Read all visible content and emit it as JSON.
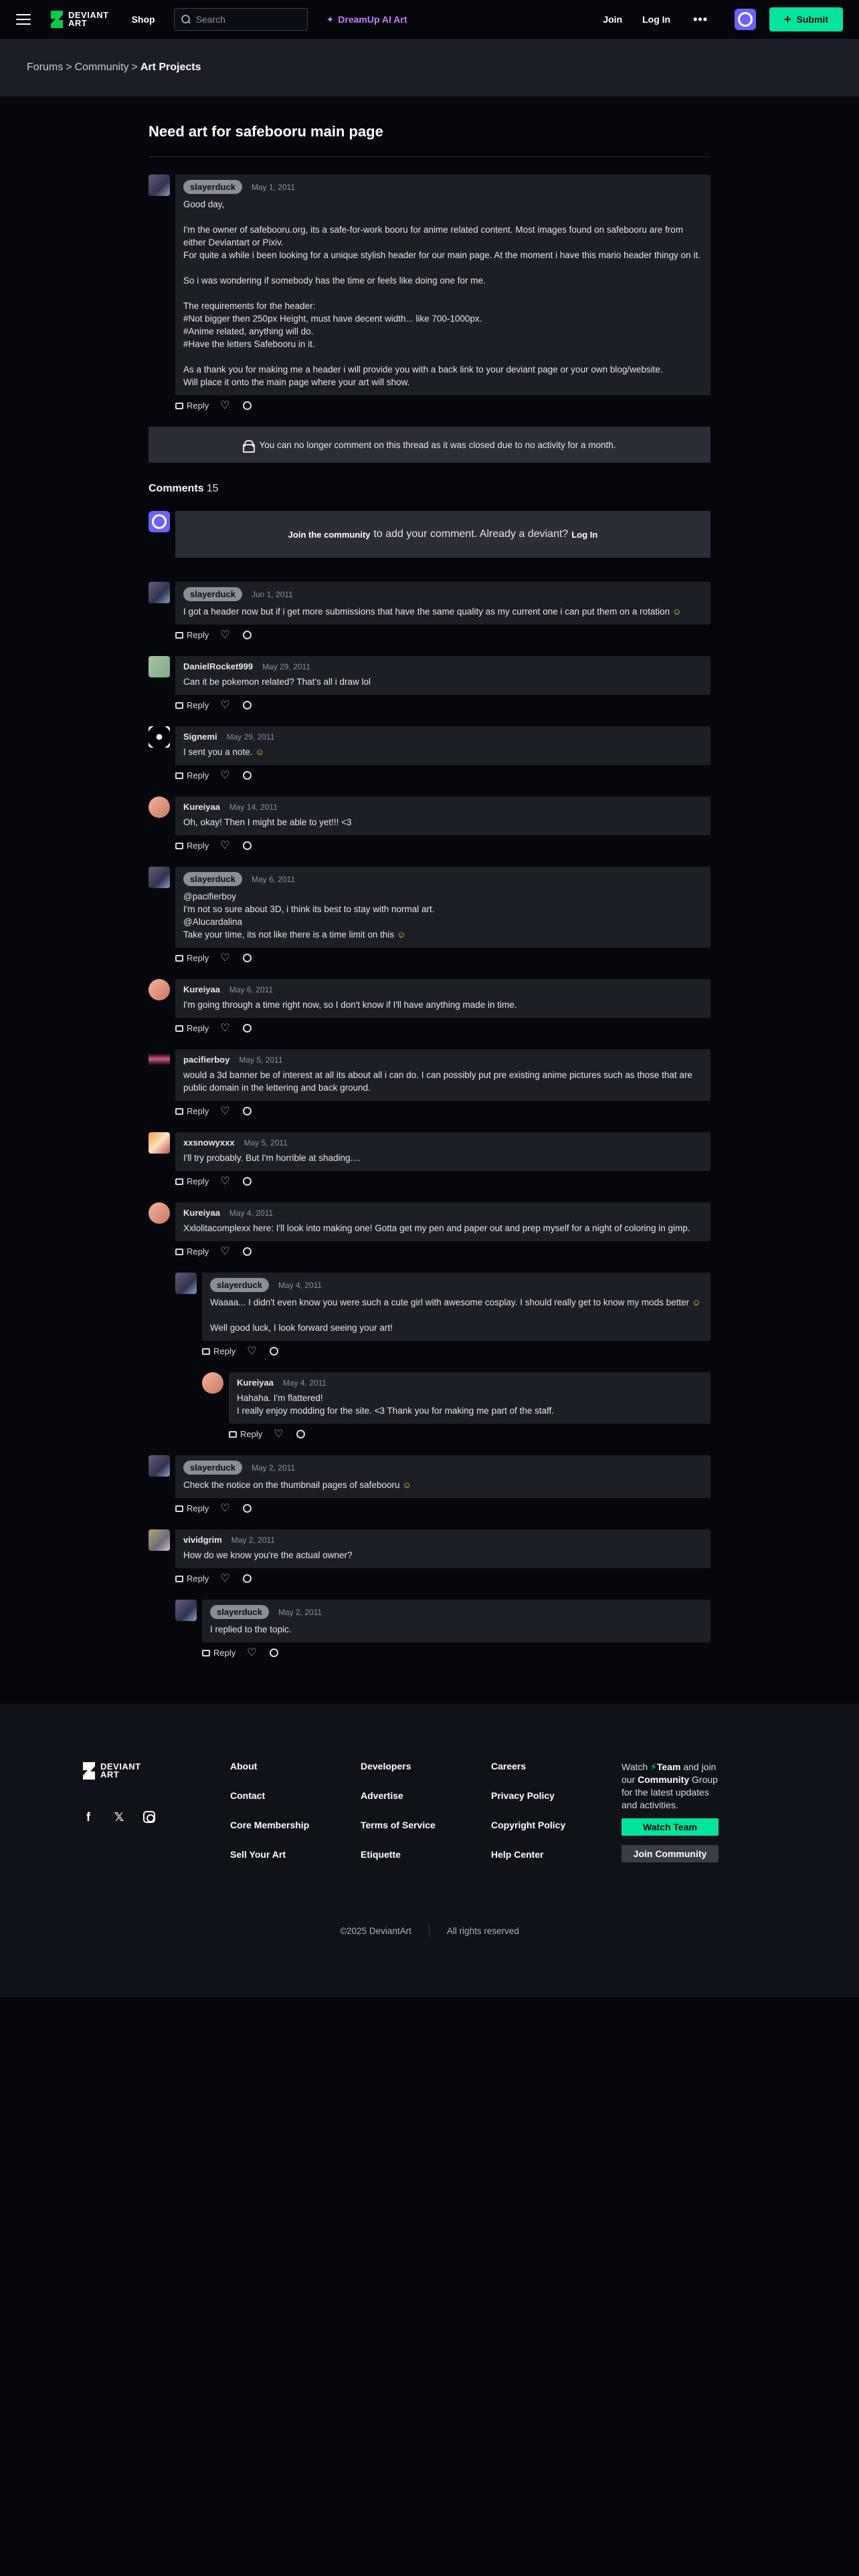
{
  "header": {
    "logo_line1": "DEVIANT",
    "logo_line2": "ART",
    "shop": "Shop",
    "search_placeholder": "Search",
    "dreamup": "DreamUp AI Art",
    "join": "Join",
    "login": "Log In",
    "more": "•••",
    "submit": "Submit"
  },
  "breadcrumb": [
    "Forums",
    "Community",
    "Art Projects"
  ],
  "thread": {
    "title": "Need art for safebooru main page",
    "op": {
      "user": "slayerduck",
      "date": "May 1, 2011",
      "text": "Good day,\n\nI'm the owner of safebooru.org, its a safe-for-work booru for anime related content. Most images found on safebooru are from either Deviantart or Pixiv.\nFor quite a while i been looking for a unique stylish header for our main page. At the moment i have this mario header thingy on it.\n\nSo i was wondering if somebody has the time or feels like doing one for me.\n\nThe requirements for the header:\n#Not bigger then 250px Height, must have decent width... like 700-1000px.\n#Anime related, anything will do.\n#Have the letters Safebooru in it.\n\nAs a thank you for making me a header i will provide you with a back link to your deviant page or your own blog/website.\nWill place it onto the main page where your art will show."
    },
    "reply_label": "Reply",
    "closed_notice": "You can no longer comment on this thread as it was closed due to no activity for a month."
  },
  "comments_label": "Comments",
  "comments_count": "15",
  "join_box": {
    "join": "Join the community",
    "middle": "to add your comment. Already a deviant?",
    "login": "Log In"
  },
  "comments": [
    {
      "user": "slayerduck",
      "badge": true,
      "date": "Jun 1, 2011",
      "text": "I got a header now but if i get more submissions that have the same quality as my current one i can put them on a rotation",
      "emoji": true
    },
    {
      "user": "DanielRocket999",
      "badge": false,
      "date": "May 29, 2011",
      "text": "Can it be pokemon related? That's all i draw lol"
    },
    {
      "user": "Signemi",
      "badge": false,
      "date": "May 29, 2011",
      "text": "I sent you a note.",
      "emoji": true
    },
    {
      "user": "Kureiyaa",
      "badge": false,
      "date": "May 14, 2011",
      "text": "Oh, okay! Then I might be able to yet!!! <3"
    },
    {
      "user": "slayerduck",
      "badge": true,
      "date": "May 6, 2011",
      "text": "@pacifierboy\nI'm not so sure about 3D, i think its best to stay with normal art.\n@Alucardalina\nTake your time, its not like there is a time limit on this",
      "emoji": true
    },
    {
      "user": "Kureiyaa",
      "badge": false,
      "date": "May 6, 2011",
      "text": "I'm going through a time right now, so I don't know if I'll have anything made in time."
    },
    {
      "user": "pacifierboy",
      "badge": false,
      "date": "May 5, 2011",
      "text": "would a 3d banner be of interest at all its about all i can do. I can possibly put pre existing anime pictures such as those that are public domain in the lettering and back ground."
    },
    {
      "user": "xxsnowyxxx",
      "badge": false,
      "date": "May 5, 2011",
      "text": "I'll try probably. But I'm horrible at shading...."
    },
    {
      "user": "Kureiyaa",
      "badge": false,
      "date": "May 4, 2011",
      "text": "Xxlolitacomplexx here: I'll look into making one! Gotta get my pen and paper out and prep myself for a night of coloring in gimp."
    },
    {
      "user": "slayerduck",
      "badge": true,
      "date": "May 4, 2011",
      "text": "Waaaa... I didn't even know you were such a cute girl with awesome cosplay. I should really get to know my mods better",
      "text2": "Well good luck, I look forward seeing your art!",
      "emoji": true
    },
    {
      "user": "Kureiyaa",
      "badge": false,
      "date": "May 4, 2011",
      "text": "Hahaha. I'm flattered!\nI really enjoy modding for the site. <3 Thank you for making me part of the staff."
    },
    {
      "user": "slayerduck",
      "badge": true,
      "date": "May 2, 2011",
      "text": "Check the notice on the thumbnail pages of safebooru",
      "emoji": true
    },
    {
      "user": "vividgrim",
      "badge": false,
      "date": "May 2, 2011",
      "text": "How do we know you're the actual owner?"
    },
    {
      "user": "slayerduck",
      "badge": true,
      "date": "May 2, 2011",
      "text": "I replied to the topic."
    }
  ],
  "footer": {
    "col1": [
      "About",
      "Contact",
      "Core Membership",
      "Sell Your Art"
    ],
    "col2": [
      "Developers",
      "Advertise",
      "Terms of Service",
      "Etiquette"
    ],
    "col3": [
      "Careers",
      "Privacy Policy",
      "Copyright Policy",
      "Help Center"
    ],
    "watch_prefix": "Watch",
    "watch_team": "Team",
    "watch_mid": "and join our",
    "watch_community": "Community",
    "watch_suffix": "Group for the latest updates and activities.",
    "watch_btn": "Watch Team",
    "join_btn": "Join Community",
    "copyright": "©2025 DeviantArt",
    "rights": "All rights reserved"
  },
  "colors": {
    "accent": "#00e59b",
    "dreamup": "#c77dff",
    "avatar": "#6c63ff"
  }
}
